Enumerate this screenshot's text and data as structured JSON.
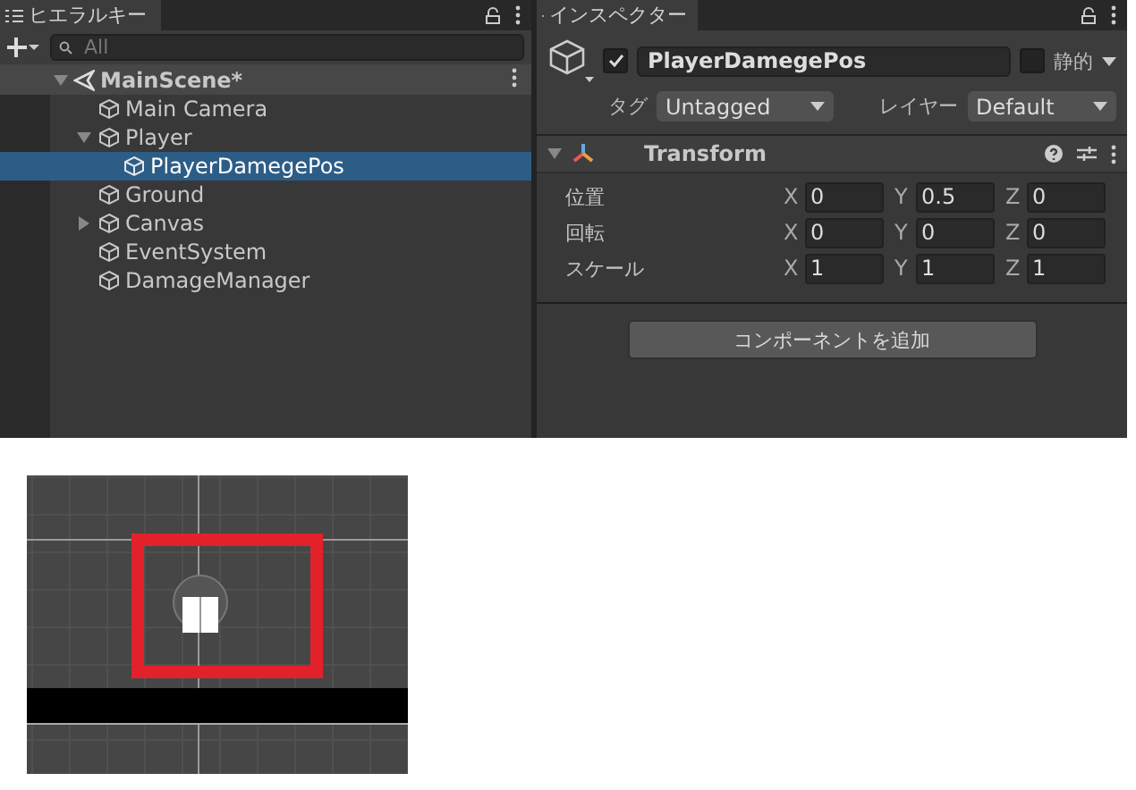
{
  "hierarchy": {
    "tab": "ヒエラルキー",
    "search": {
      "placeholder": "All"
    },
    "scene": {
      "name": "MainScene*",
      "expanded": true
    },
    "items": [
      {
        "name": "Main Camera",
        "selected": false
      },
      {
        "name": "Player",
        "selected": false,
        "expanded": true,
        "children": [
          {
            "name": "PlayerDamegePos",
            "selected": true
          }
        ]
      },
      {
        "name": "Ground",
        "selected": false
      },
      {
        "name": "Canvas",
        "selected": false,
        "expanded": false
      },
      {
        "name": "EventSystem",
        "selected": false
      },
      {
        "name": "DamageManager",
        "selected": false
      }
    ]
  },
  "inspector": {
    "tab": "インスペクター",
    "object": {
      "active": true,
      "name": "PlayerDamegePos",
      "static": false,
      "static_label": "静的",
      "tag_label": "タグ",
      "tag": "Untagged",
      "layer_label": "レイヤー",
      "layer": "Default"
    },
    "component": {
      "title": "Transform",
      "expanded": true,
      "rows": [
        {
          "label": "位置",
          "fields": [
            {
              "axis": "X",
              "value": "0"
            },
            {
              "axis": "Y",
              "value": "0.5"
            },
            {
              "axis": "Z",
              "value": "0"
            }
          ]
        },
        {
          "label": "回転",
          "fields": [
            {
              "axis": "X",
              "value": "0"
            },
            {
              "axis": "Y",
              "value": "0"
            },
            {
              "axis": "Z",
              "value": "0"
            }
          ]
        },
        {
          "label": "スケール",
          "fields": [
            {
              "axis": "X",
              "value": "1"
            },
            {
              "axis": "Y",
              "value": "1"
            },
            {
              "axis": "Z",
              "value": "1"
            }
          ]
        }
      ]
    },
    "add_button": "コンポーネントを追加"
  },
  "scene_view": {
    "kind": "picture",
    "highlight": true
  }
}
